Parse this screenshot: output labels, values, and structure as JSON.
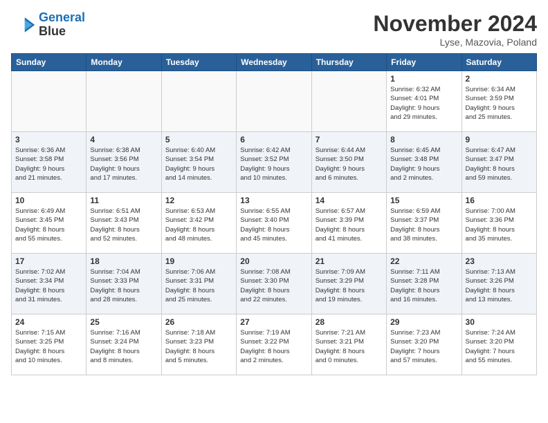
{
  "header": {
    "logo_line1": "General",
    "logo_line2": "Blue",
    "month_title": "November 2024",
    "location": "Lyse, Mazovia, Poland"
  },
  "columns": [
    "Sunday",
    "Monday",
    "Tuesday",
    "Wednesday",
    "Thursday",
    "Friday",
    "Saturday"
  ],
  "weeks": [
    [
      {
        "day": "",
        "info": ""
      },
      {
        "day": "",
        "info": ""
      },
      {
        "day": "",
        "info": ""
      },
      {
        "day": "",
        "info": ""
      },
      {
        "day": "",
        "info": ""
      },
      {
        "day": "1",
        "info": "Sunrise: 6:32 AM\nSunset: 4:01 PM\nDaylight: 9 hours\nand 29 minutes."
      },
      {
        "day": "2",
        "info": "Sunrise: 6:34 AM\nSunset: 3:59 PM\nDaylight: 9 hours\nand 25 minutes."
      }
    ],
    [
      {
        "day": "3",
        "info": "Sunrise: 6:36 AM\nSunset: 3:58 PM\nDaylight: 9 hours\nand 21 minutes."
      },
      {
        "day": "4",
        "info": "Sunrise: 6:38 AM\nSunset: 3:56 PM\nDaylight: 9 hours\nand 17 minutes."
      },
      {
        "day": "5",
        "info": "Sunrise: 6:40 AM\nSunset: 3:54 PM\nDaylight: 9 hours\nand 14 minutes."
      },
      {
        "day": "6",
        "info": "Sunrise: 6:42 AM\nSunset: 3:52 PM\nDaylight: 9 hours\nand 10 minutes."
      },
      {
        "day": "7",
        "info": "Sunrise: 6:44 AM\nSunset: 3:50 PM\nDaylight: 9 hours\nand 6 minutes."
      },
      {
        "day": "8",
        "info": "Sunrise: 6:45 AM\nSunset: 3:48 PM\nDaylight: 9 hours\nand 2 minutes."
      },
      {
        "day": "9",
        "info": "Sunrise: 6:47 AM\nSunset: 3:47 PM\nDaylight: 8 hours\nand 59 minutes."
      }
    ],
    [
      {
        "day": "10",
        "info": "Sunrise: 6:49 AM\nSunset: 3:45 PM\nDaylight: 8 hours\nand 55 minutes."
      },
      {
        "day": "11",
        "info": "Sunrise: 6:51 AM\nSunset: 3:43 PM\nDaylight: 8 hours\nand 52 minutes."
      },
      {
        "day": "12",
        "info": "Sunrise: 6:53 AM\nSunset: 3:42 PM\nDaylight: 8 hours\nand 48 minutes."
      },
      {
        "day": "13",
        "info": "Sunrise: 6:55 AM\nSunset: 3:40 PM\nDaylight: 8 hours\nand 45 minutes."
      },
      {
        "day": "14",
        "info": "Sunrise: 6:57 AM\nSunset: 3:39 PM\nDaylight: 8 hours\nand 41 minutes."
      },
      {
        "day": "15",
        "info": "Sunrise: 6:59 AM\nSunset: 3:37 PM\nDaylight: 8 hours\nand 38 minutes."
      },
      {
        "day": "16",
        "info": "Sunrise: 7:00 AM\nSunset: 3:36 PM\nDaylight: 8 hours\nand 35 minutes."
      }
    ],
    [
      {
        "day": "17",
        "info": "Sunrise: 7:02 AM\nSunset: 3:34 PM\nDaylight: 8 hours\nand 31 minutes."
      },
      {
        "day": "18",
        "info": "Sunrise: 7:04 AM\nSunset: 3:33 PM\nDaylight: 8 hours\nand 28 minutes."
      },
      {
        "day": "19",
        "info": "Sunrise: 7:06 AM\nSunset: 3:31 PM\nDaylight: 8 hours\nand 25 minutes."
      },
      {
        "day": "20",
        "info": "Sunrise: 7:08 AM\nSunset: 3:30 PM\nDaylight: 8 hours\nand 22 minutes."
      },
      {
        "day": "21",
        "info": "Sunrise: 7:09 AM\nSunset: 3:29 PM\nDaylight: 8 hours\nand 19 minutes."
      },
      {
        "day": "22",
        "info": "Sunrise: 7:11 AM\nSunset: 3:28 PM\nDaylight: 8 hours\nand 16 minutes."
      },
      {
        "day": "23",
        "info": "Sunrise: 7:13 AM\nSunset: 3:26 PM\nDaylight: 8 hours\nand 13 minutes."
      }
    ],
    [
      {
        "day": "24",
        "info": "Sunrise: 7:15 AM\nSunset: 3:25 PM\nDaylight: 8 hours\nand 10 minutes."
      },
      {
        "day": "25",
        "info": "Sunrise: 7:16 AM\nSunset: 3:24 PM\nDaylight: 8 hours\nand 8 minutes."
      },
      {
        "day": "26",
        "info": "Sunrise: 7:18 AM\nSunset: 3:23 PM\nDaylight: 8 hours\nand 5 minutes."
      },
      {
        "day": "27",
        "info": "Sunrise: 7:19 AM\nSunset: 3:22 PM\nDaylight: 8 hours\nand 2 minutes."
      },
      {
        "day": "28",
        "info": "Sunrise: 7:21 AM\nSunset: 3:21 PM\nDaylight: 8 hours\nand 0 minutes."
      },
      {
        "day": "29",
        "info": "Sunrise: 7:23 AM\nSunset: 3:20 PM\nDaylight: 7 hours\nand 57 minutes."
      },
      {
        "day": "30",
        "info": "Sunrise: 7:24 AM\nSunset: 3:20 PM\nDaylight: 7 hours\nand 55 minutes."
      }
    ]
  ]
}
